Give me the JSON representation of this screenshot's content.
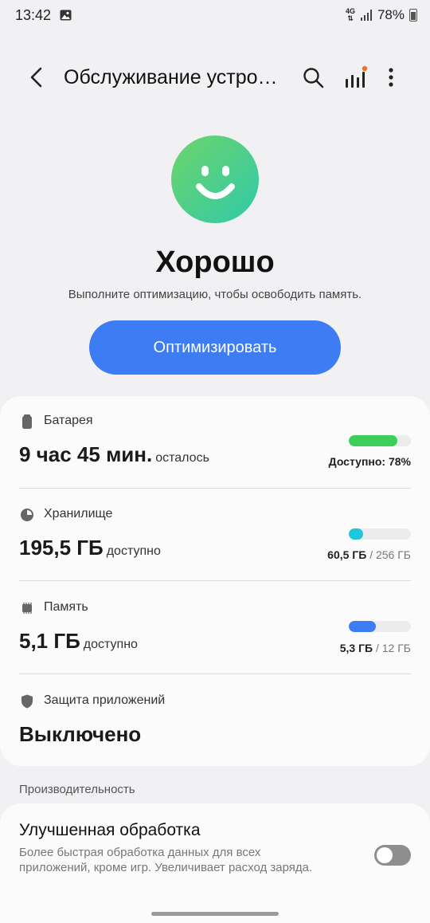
{
  "status_bar": {
    "time": "13:42",
    "network": "4G",
    "battery_percent": "78%",
    "icons": [
      "gallery-icon",
      "network-4g-icon",
      "signal-icon",
      "battery-icon"
    ]
  },
  "app_bar": {
    "title": "Обслуживание устройства",
    "icons": [
      "back-arrow-icon",
      "search-icon",
      "stats-icon",
      "more-vert-icon"
    ],
    "stats_badge_color": "#f07030"
  },
  "hero": {
    "status_title": "Хорошо",
    "status_subtitle": "Выполните оптимизацию, чтобы освободить память.",
    "optimize_label": "Оптимизировать"
  },
  "rows": {
    "battery": {
      "label": "Батарея",
      "value": "9 час 45 мин.",
      "suffix": "осталось",
      "meta_label": "Доступно: 78%",
      "level": 0.78,
      "color": "#3ecf5b"
    },
    "storage": {
      "label": "Хранилище",
      "value": "195,5 ГБ",
      "suffix": "доступно",
      "used": "60,5 ГБ",
      "total": "/ 256 ГБ",
      "level": 0.236,
      "color": "#1fc6dc"
    },
    "memory": {
      "label": "Память",
      "value": "5,1 ГБ",
      "suffix": "доступно",
      "used": "5,3 ГБ",
      "total": "/ 12 ГБ",
      "level": 0.44,
      "color": "#3d7cf3"
    },
    "app_protection": {
      "label": "Защита приложений",
      "value": "Выключено"
    }
  },
  "performance": {
    "section_label": "Производительность",
    "title": "Улучшенная обработка",
    "description": "Более быстрая обработка данных для всех приложений, кроме игр. Увеличивает расход заряда.",
    "toggle_on": false
  },
  "accent_color": "#3d7cf3"
}
